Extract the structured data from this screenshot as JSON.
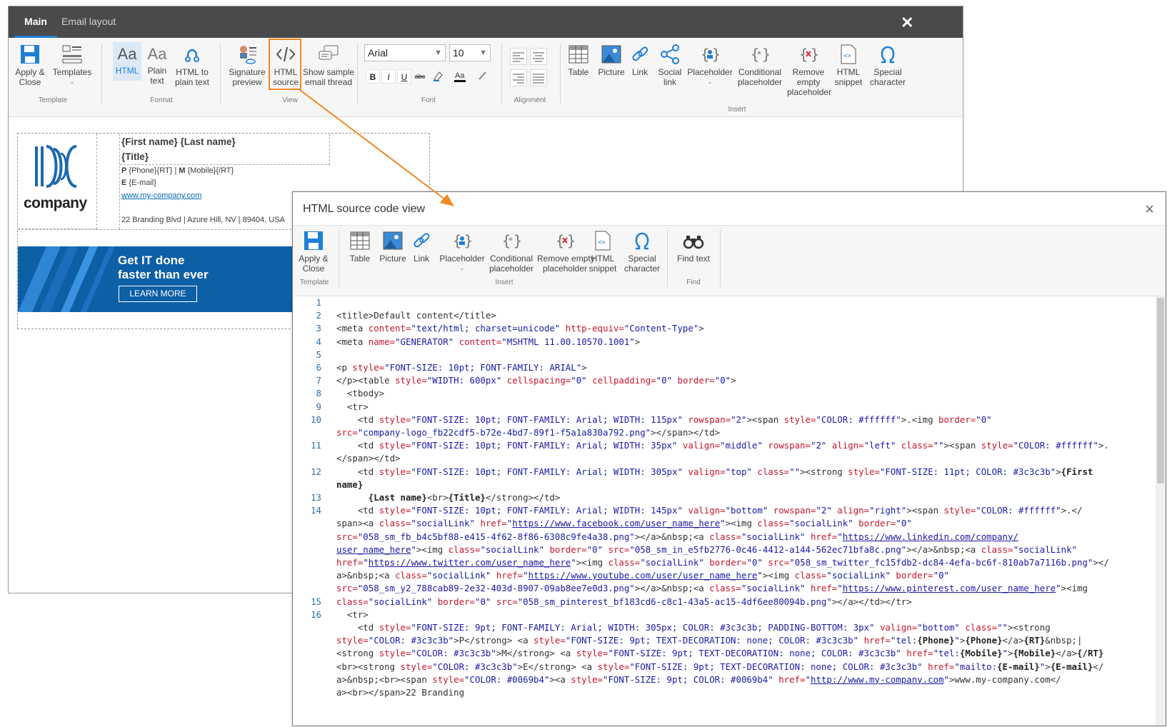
{
  "editor": {
    "tabs": [
      {
        "label": "Main"
      },
      {
        "label": "Email layout"
      }
    ],
    "close_glyph": "✕",
    "groups": {
      "template": "Template",
      "format": "Format",
      "view": "View",
      "font": "Font",
      "alignment": "Alignment",
      "insert": "Insert"
    },
    "buttons": {
      "apply_close": "Apply &\nClose",
      "templates": "Templates",
      "html": "HTML",
      "plain_text": "Plain\ntext",
      "html_to_plain": "HTML to\nplain text",
      "signature_preview": "Signature\npreview",
      "html_source": "HTML\nsource",
      "show_sample": "Show sample\nemail thread",
      "table": "Table",
      "picture": "Picture",
      "link": "Link",
      "social_link": "Social\nlink",
      "placeholder": "Placeholder",
      "conditional_placeholder": "Conditional\nplaceholder",
      "remove_empty_placeholder": "Remove\nempty\nplaceholder",
      "html_snippet": "HTML\nsnippet",
      "special_character": "Special\ncharacter"
    },
    "font_name": "Arial",
    "font_size": "10",
    "format_buttons": [
      "B",
      "I",
      "U",
      "abc"
    ],
    "accent_color": "#1e7fd6",
    "signature": {
      "name": "{First name} {Last name}",
      "title": "{Title}",
      "phone_prefix": "P",
      "phone_value": "{Phone}{RT}",
      "separator": "|",
      "mobile_prefix": "M",
      "mobile_value": "{Mobile}{/RT}",
      "email_prefix": "E",
      "email_value": "{E-mail}",
      "website": "www.my-company.com",
      "address": "22 Branding Blvd | Azure Hill, NV | 89404, USA",
      "logo_text": "company",
      "banner_line1": "Get IT done",
      "banner_line2": "faster than ever",
      "banner_button": "LEARN MORE"
    }
  },
  "dialog": {
    "title": "HTML source code view",
    "close_glyph": "×",
    "groups": {
      "template": "Template",
      "insert": "Insert",
      "find": "Find"
    },
    "buttons": {
      "apply_close": "Apply &\nClose",
      "table": "Table",
      "picture": "Picture",
      "link": "Link",
      "placeholder": "Placeholder",
      "conditional_placeholder": "Conditional\nplaceholder",
      "remove_empty_placeholder": "Remove empty\nplaceholder",
      "html_snippet": "HTML\nsnippet",
      "special_character": "Special\ncharacter",
      "find_text": "Find text"
    },
    "line_numbers": [
      "1",
      "2",
      "3",
      "4",
      "5",
      "6",
      "7",
      "8",
      "9",
      "10",
      "",
      "11",
      "",
      "12",
      "",
      "13",
      "14",
      "",
      "",
      "",
      "",
      "",
      "",
      "15",
      "16",
      "",
      "",
      "",
      ""
    ]
  }
}
